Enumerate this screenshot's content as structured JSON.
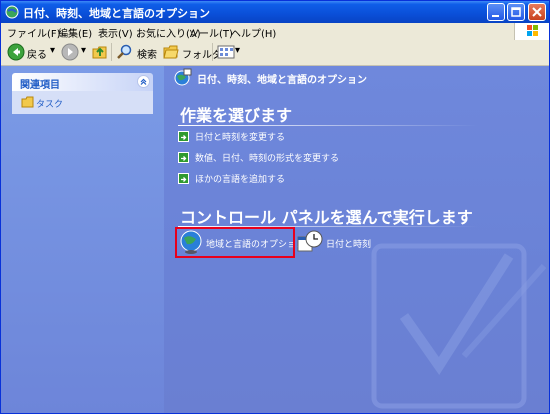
{
  "window": {
    "title": "日付、時刻、地域と言語のオプション"
  },
  "menubar": {
    "items": [
      "ファイル(F)",
      "編集(E)",
      "表示(V)",
      "お気に入り(A)",
      "ツール(T)",
      "ヘルプ(H)"
    ]
  },
  "toolbar": {
    "back_label": "戻る",
    "search_label": "検索",
    "folders_label": "フォルダ"
  },
  "sidebar": {
    "header": "関連項目",
    "task_link": "タスク"
  },
  "main": {
    "header": "日付、時刻、地域と言語のオプション",
    "pick_task_title": "作業を選びます",
    "tasks": [
      "日付と時刻を変更する",
      "数値、日付、時刻の形式を変更する",
      "ほかの言語を追加する"
    ],
    "control_title": "コントロール パネルを選んで実行します",
    "applets": [
      {
        "label": "地域と言語のオプション",
        "icon": "globe-icon"
      },
      {
        "label": "日付と時刻",
        "icon": "clock-icon"
      }
    ]
  },
  "colors": {
    "titlebar": "#0a4fd8",
    "pane_bg": "#6a82d6",
    "highlight": "#e8001c"
  }
}
